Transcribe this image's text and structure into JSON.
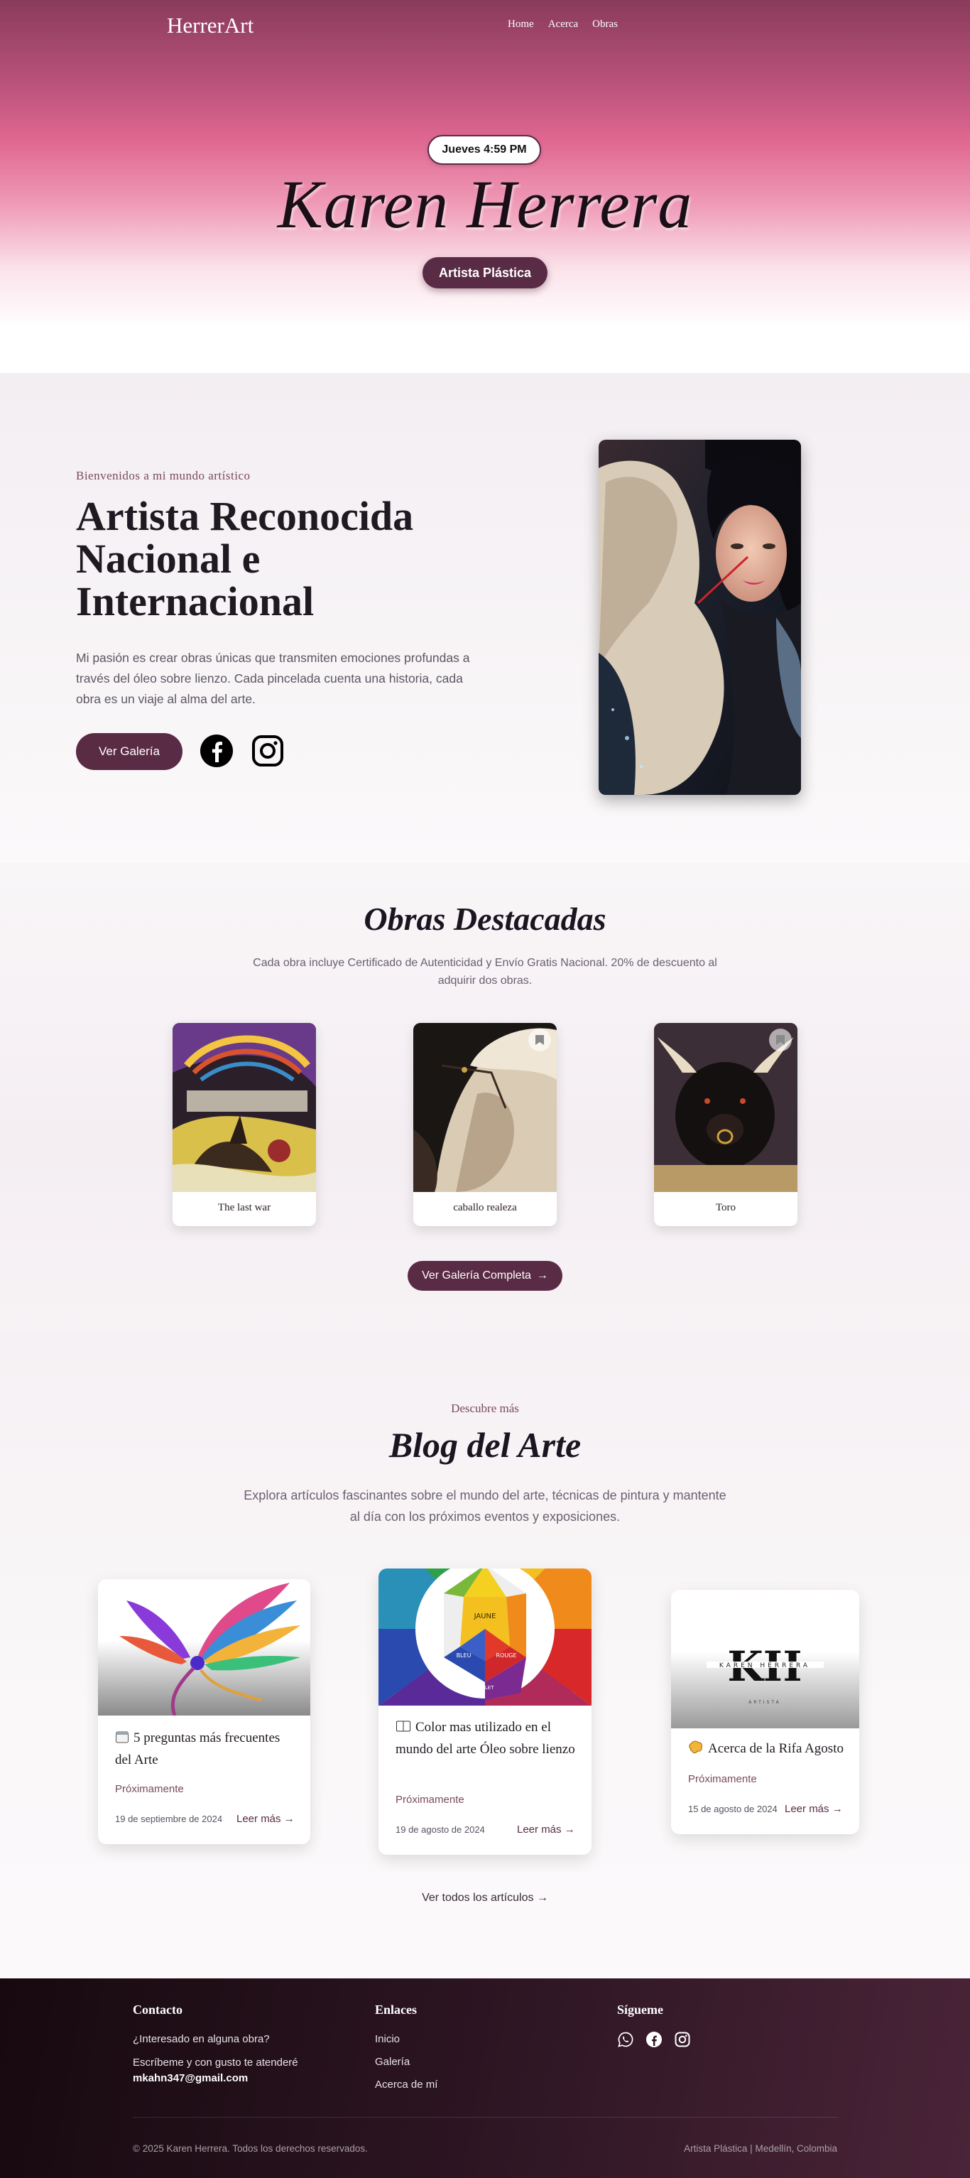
{
  "header": {
    "brand": "HerrerArt",
    "nav": [
      "Home",
      "Acerca",
      "Obras"
    ],
    "time": "Jueves 4:59 PM",
    "artist_name": "Karen Herrera",
    "role": "Artista Plástica"
  },
  "about": {
    "welcome": "Bienvenidos a mi mundo artístico",
    "title": "Artista Reconocida Nacional e Internacional",
    "text": "Mi pasión es crear obras únicas que transmiten emociones profundas a través del óleo sobre lienzo. Cada pincelada cuenta una historia, cada obra es un viaje al alma del arte.",
    "gallery_button": "Ver Galería",
    "social_icons": [
      "facebook-icon",
      "instagram-icon"
    ]
  },
  "featured": {
    "title": "Obras Destacadas",
    "description": "Cada obra incluye Certificado de Autenticidad y Envío Gratis Nacional. 20% de descuento al adquirir dos obras.",
    "artworks": [
      {
        "title": "The last war"
      },
      {
        "title": "caballo realeza"
      },
      {
        "title": "Toro"
      }
    ],
    "full_gallery_button": "Ver Galería Completa",
    "arrow": "→"
  },
  "blog": {
    "kicker": "Descubre más",
    "title": "Blog del Arte",
    "description": "Explora artículos fascinantes sobre el mundo del arte, técnicas de pintura y mantente al día con los próximos eventos y exposiciones.",
    "posts": [
      {
        "icon": "calendar-icon",
        "title": "5 preguntas más frecuentes del Arte",
        "status": "Próximamente",
        "date": "19 de septiembre de 2024",
        "more": "Leer más →"
      },
      {
        "icon": "book-icon",
        "title": "Color mas utilizado en el mundo del arte Óleo sobre lienzo",
        "status": "Próximamente",
        "date": "19 de agosto de 2024",
        "more": "Leer más →"
      },
      {
        "icon": "brain-icon",
        "title": "Acerca de la Rifa Agosto",
        "status": "Próximamente",
        "date": "15 de agosto de 2024",
        "more": "Leer más →"
      }
    ],
    "wheel_labels": [
      "JAUNE",
      "ROUGE",
      "BLEU",
      "VIOLET"
    ],
    "logo_text": {
      "initials": "KH",
      "name": "KAREN HERRERA",
      "sub": "ARTISTA"
    },
    "all_posts": "Ver todos los artículos"
  },
  "footer": {
    "contact_title": "Contacto",
    "contact_question": "¿Interesado en alguna obra?",
    "contact_line": "Escríbeme y con gusto te atenderé",
    "email": "mkahn347@gmail.com",
    "links_title": "Enlaces",
    "links": [
      "Inicio",
      "Galería",
      "Acerca de mí"
    ],
    "follow_title": "Sígueme",
    "social_icons": [
      "whatsapp-icon",
      "facebook-icon",
      "instagram-icon"
    ],
    "copyright": "© 2025 Karen Herrera. Todos los derechos reservados.",
    "location": "Artista Plástica | Medellín, Colombia"
  },
  "colors": {
    "accent": "#5a2b45",
    "hero_pink": "#e06891",
    "footer_dark": "#17090f"
  }
}
